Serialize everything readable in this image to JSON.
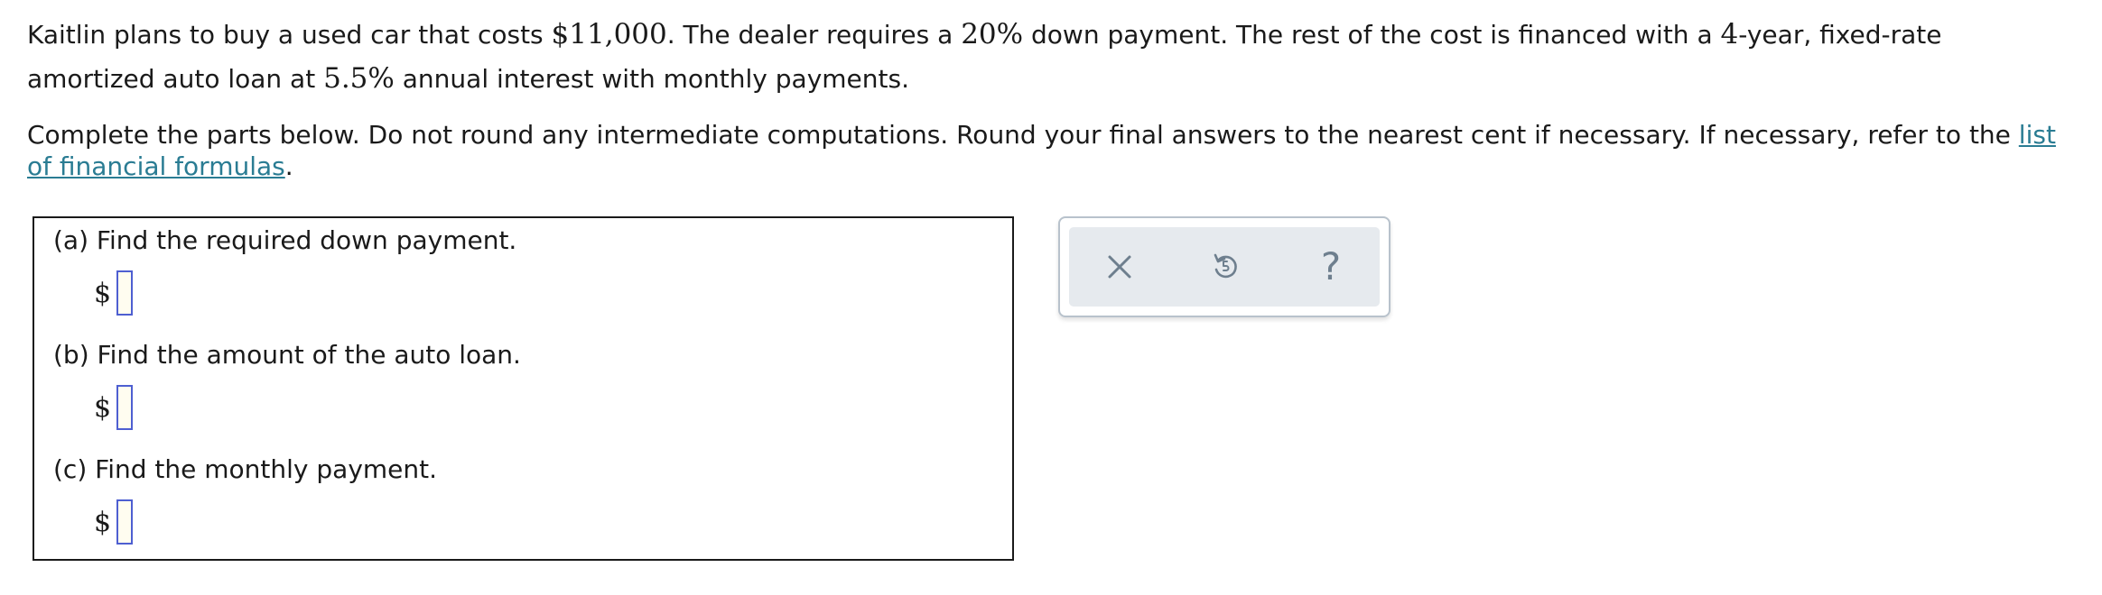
{
  "problem": {
    "t1": "Kaitlin plans to buy a used car that costs ",
    "cost": "$11,000",
    "t2": ". The dealer requires a ",
    "down_pct": "20%",
    "t3": " down payment. The rest of the cost is financed with a ",
    "years": "4",
    "t4": "-year, fixed-rate amortized auto loan at ",
    "rate": "5.5%",
    "t5": " annual interest with monthly payments."
  },
  "instructions": {
    "text": "Complete the parts below. Do not round any intermediate computations. Round your final answers to the nearest cent if necessary. If necessary, refer to the ",
    "link": "list of financial formulas",
    "end": "."
  },
  "parts": {
    "a": {
      "question": "(a) Find the required down payment.",
      "currency": "$",
      "value": ""
    },
    "b": {
      "question": "(b) Find the amount of the auto loan.",
      "currency": "$",
      "value": ""
    },
    "c": {
      "question": "(c) Find the monthly payment.",
      "currency": "$",
      "value": ""
    }
  },
  "toolbar": {
    "clear_icon": "close-icon",
    "undo_icon": "undo-icon",
    "help_icon": "help-icon",
    "help_glyph": "?",
    "icon_color": "#6e7f8e"
  }
}
